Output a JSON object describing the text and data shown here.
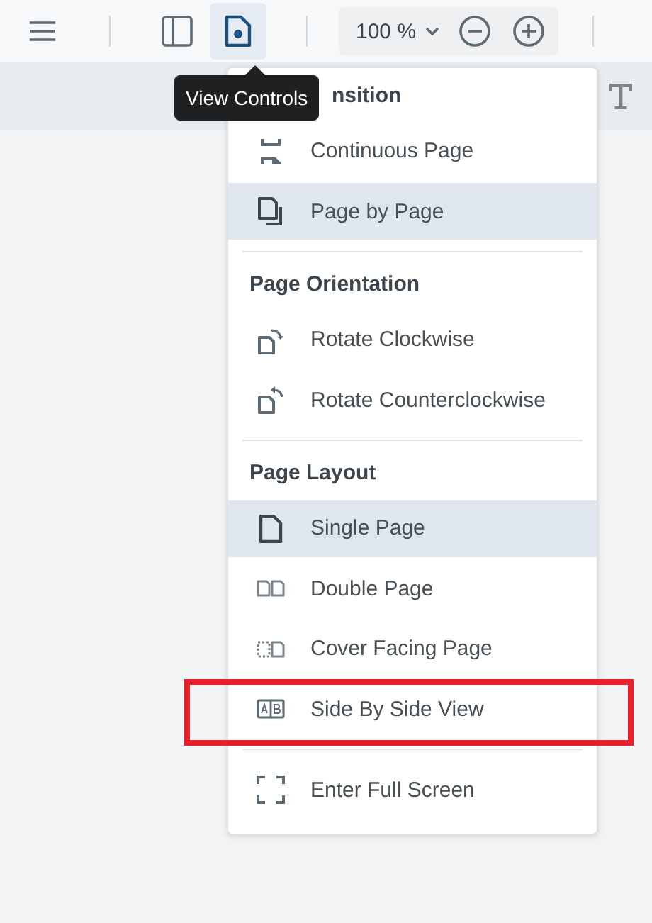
{
  "toolbar": {
    "view_controls_selected": true,
    "zoom": "100 %"
  },
  "tooltip": "View Controls",
  "menu": {
    "sections": [
      {
        "heading": "nsition",
        "items": [
          {
            "label": "Continuous Page",
            "selected": false,
            "highlighted": false
          },
          {
            "label": "Page by Page",
            "selected": true,
            "highlighted": false
          }
        ]
      },
      {
        "heading": "Page Orientation",
        "items": [
          {
            "label": "Rotate Clockwise",
            "selected": false,
            "highlighted": false
          },
          {
            "label": "Rotate Counterclockwise",
            "selected": false,
            "highlighted": false
          }
        ]
      },
      {
        "heading": "Page Layout",
        "items": [
          {
            "label": "Single Page",
            "selected": true,
            "highlighted": false
          },
          {
            "label": "Double Page",
            "selected": false,
            "highlighted": false
          },
          {
            "label": "Cover Facing Page",
            "selected": false,
            "highlighted": false
          },
          {
            "label": "Side By Side View",
            "selected": false,
            "highlighted": true
          }
        ]
      },
      {
        "items": [
          {
            "label": "Enter Full Screen",
            "selected": false,
            "highlighted": false
          }
        ]
      }
    ]
  }
}
